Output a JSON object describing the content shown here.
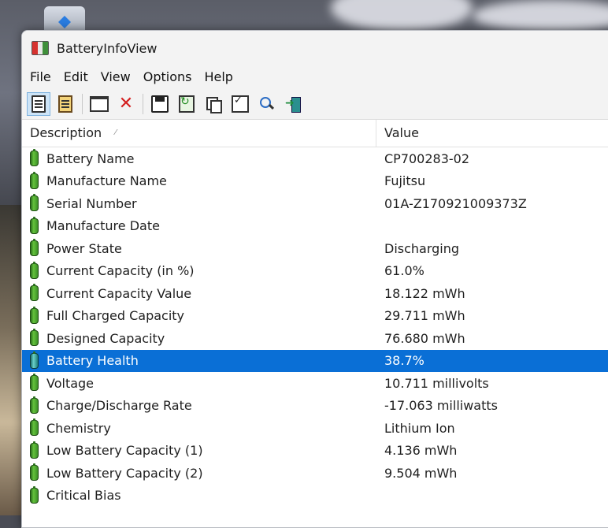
{
  "window": {
    "title": "BatteryInfoView"
  },
  "menu": [
    "File",
    "Edit",
    "View",
    "Options",
    "Help"
  ],
  "toolbar": {
    "buttons": [
      {
        "name": "html-report-icon"
      },
      {
        "name": "clipboard-icon"
      },
      {
        "name": "window-icon"
      },
      {
        "name": "delete-icon"
      },
      {
        "name": "save-icon"
      },
      {
        "name": "refresh-icon"
      },
      {
        "name": "copy-icon"
      },
      {
        "name": "properties-icon"
      },
      {
        "name": "find-icon"
      },
      {
        "name": "exit-icon"
      }
    ]
  },
  "list": {
    "columns": [
      "Description",
      "Value"
    ],
    "rows": [
      {
        "description": "Battery Name",
        "value": "CP700283-02"
      },
      {
        "description": "Manufacture Name",
        "value": "Fujitsu"
      },
      {
        "description": "Serial Number",
        "value": "01A-Z170921009373Z"
      },
      {
        "description": "Manufacture Date",
        "value": ""
      },
      {
        "description": "Power State",
        "value": "Discharging"
      },
      {
        "description": "Current Capacity (in %)",
        "value": "61.0%"
      },
      {
        "description": "Current Capacity Value",
        "value": "18.122 mWh"
      },
      {
        "description": "Full Charged Capacity",
        "value": "29.711 mWh"
      },
      {
        "description": "Designed Capacity",
        "value": "76.680 mWh"
      },
      {
        "description": "Battery Health",
        "value": "38.7%",
        "selected": true
      },
      {
        "description": "Voltage",
        "value": "10.711 millivolts"
      },
      {
        "description": "Charge/Discharge Rate",
        "value": "-17.063 milliwatts"
      },
      {
        "description": "Chemistry",
        "value": "Lithium Ion"
      },
      {
        "description": "Low Battery Capacity (1)",
        "value": "4.136 mWh"
      },
      {
        "description": "Low Battery Capacity (2)",
        "value": "9.504 mWh"
      },
      {
        "description": "Critical Bias",
        "value": ""
      }
    ]
  },
  "colors": {
    "selection": "#0a6fd6",
    "battery_green": "#3c8f25"
  }
}
